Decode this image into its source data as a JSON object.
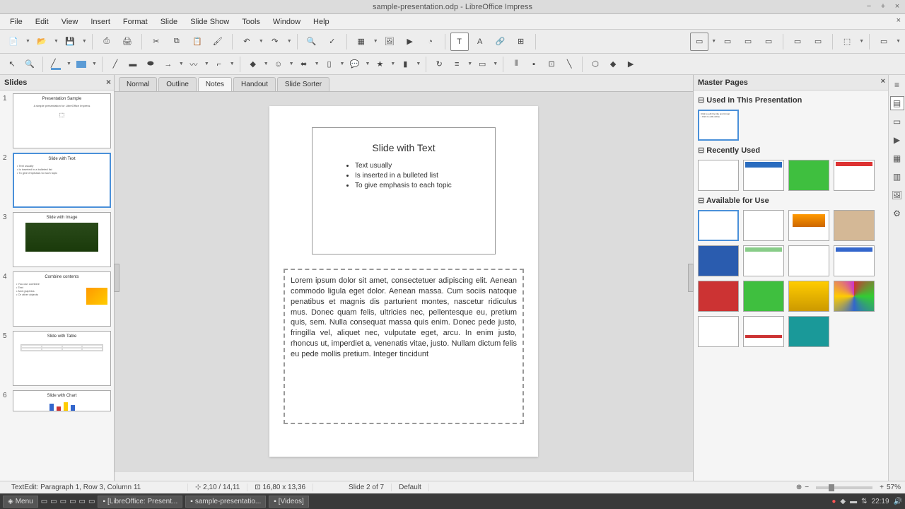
{
  "window": {
    "title": "sample-presentation.odp - LibreOffice Impress"
  },
  "menubar": [
    "File",
    "Edit",
    "View",
    "Insert",
    "Format",
    "Slide",
    "Slide Show",
    "Tools",
    "Window",
    "Help"
  ],
  "slides_panel": {
    "title": "Slides",
    "slides": [
      {
        "num": "1",
        "title": "Presentation Sample",
        "body": "A simple presentation for LibreOffice Impress"
      },
      {
        "num": "2",
        "title": "Slide with Text",
        "body": "• Text usually\n• Is inserted in a bulleted list\n• To give emphasis to each topic"
      },
      {
        "num": "3",
        "title": "Slide with Image",
        "body": ""
      },
      {
        "num": "4",
        "title": "Combine contents",
        "body": "• You can combine\n• Text\n• And graphics\n• Or other objects"
      },
      {
        "num": "5",
        "title": "Slide with Table",
        "body": ""
      },
      {
        "num": "6",
        "title": "Slide with Chart",
        "body": ""
      }
    ]
  },
  "view_tabs": [
    "Normal",
    "Outline",
    "Notes",
    "Handout",
    "Slide Sorter"
  ],
  "active_view_tab": "Notes",
  "current_slide": {
    "title": "Slide with Text",
    "bullets": [
      "Text usually",
      "Is inserted in a bulleted list",
      "To give emphasis to each topic"
    ]
  },
  "notes_text": "Lorem ipsum dolor sit amet, consectetuer adipiscing elit. Aenean commodo ligula eget dolor. Aenean massa. Cum sociis natoque penatibus et magnis dis parturient montes, nascetur ridiculus mus. Donec quam felis, ultricies nec, pellentesque eu, pretium quis, sem. Nulla consequat massa quis enim. Donec pede justo, fringilla vel, aliquet nec, vulputate eget, arcu. In enim justo, rhoncus ut, imperdiet a, venenatis vitae, justo. Nullam dictum felis eu pede mollis pretium. Integer tincidunt",
  "master_panel": {
    "title": "Master Pages",
    "sections": {
      "used": "Used in This Presentation",
      "recent": "Recently Used",
      "available": "Available for Use"
    }
  },
  "statusbar": {
    "edit_mode": "TextEdit: Paragraph 1, Row 3, Column 11",
    "pos": "2,10 / 14,11",
    "size": "16,80 x 13,36",
    "slide_info": "Slide 2 of 7",
    "master": "Default",
    "zoom": "57%"
  },
  "taskbar": {
    "menu": "Menu",
    "items": [
      "[LibreOffice: Present...",
      "sample-presentatio...",
      "[Videos]"
    ],
    "time": "22:19"
  }
}
